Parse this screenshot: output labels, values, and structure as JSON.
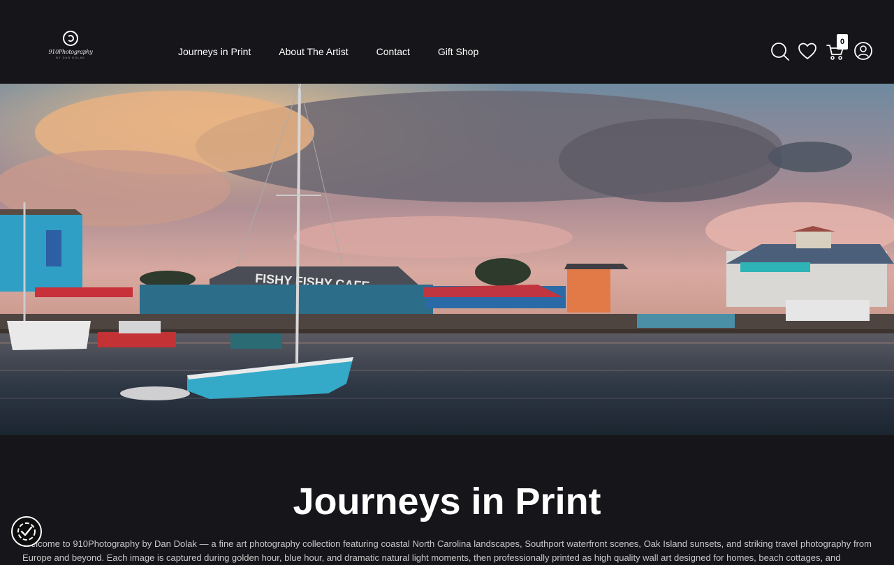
{
  "brand": {
    "logo_text": "910Photography",
    "logo_subtext": "BY DAN DOLAK"
  },
  "nav": {
    "items": [
      {
        "label": "Journeys in Print"
      },
      {
        "label": "About The Artist"
      },
      {
        "label": "Contact"
      },
      {
        "label": "Gift Shop"
      }
    ]
  },
  "header_icons": {
    "search": "search-icon",
    "wishlist": "heart-icon",
    "cart": "cart-icon",
    "account": "user-icon",
    "cart_count": "0"
  },
  "hero": {
    "building_sign": "FISHY FISHY CAFE"
  },
  "main": {
    "title": "Journeys in Print",
    "intro": "Welcome to 910Photography by Dan Dolak — a fine art photography collection featuring coastal North Carolina landscapes, Southport waterfront scenes, Oak Island sunsets, and striking travel photography from Europe and beyond. Each image is captured during golden hour, blue hour, and dramatic natural light moments, then professionally printed as high quality wall art designed for homes, beach cottages, and"
  },
  "consent": {
    "icon": "cookie-consent-icon"
  },
  "colors": {
    "background": "#16161a",
    "text": "#ffffff",
    "body_text": "#c9c9c9"
  }
}
